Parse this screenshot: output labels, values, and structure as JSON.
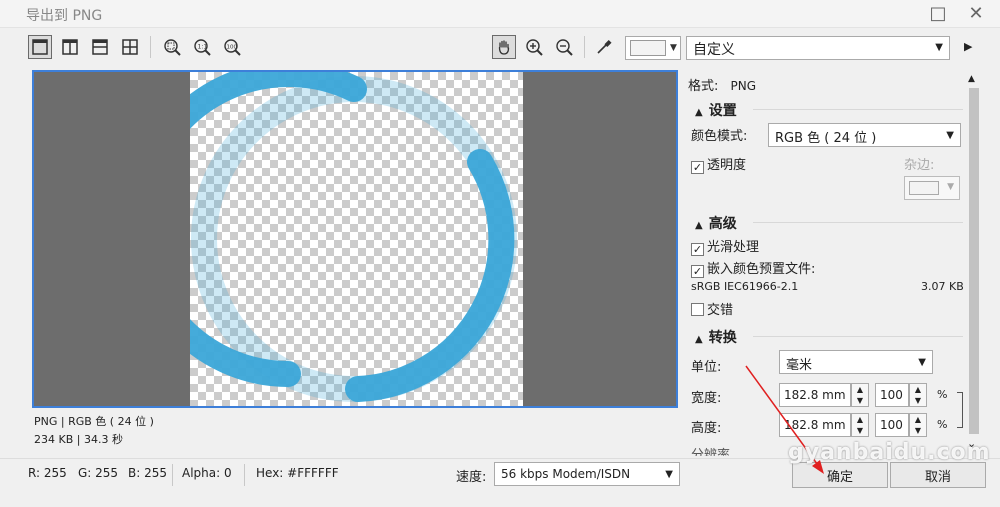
{
  "window": {
    "title": "导出到 PNG",
    "maximize_icon": "□",
    "close_icon": "✕"
  },
  "toolbar": {
    "preset": "自定义",
    "more_icon": "▶"
  },
  "preview": {
    "info_format": "PNG | RGB 色 ( 24 位 )",
    "info_size": "234 KB | 34.3 秒",
    "colors": {
      "ring": "#3ba7d8",
      "frame": "#3d7fd9",
      "background": "#6d6d6d"
    }
  },
  "panel": {
    "format_label": "格式:",
    "format_value": "PNG",
    "settings_title": "设置",
    "color_mode_label": "颜色模式:",
    "color_mode_value": "RGB 色 ( 24 位 )",
    "transparency_label": "透明度",
    "transparency_checked": "✓",
    "matte_label": "杂边:",
    "advanced_title": "高级",
    "antialias_label": "光滑处理",
    "antialias_checked": "✓",
    "embed_profile_label": "嵌入颜色预置文件:",
    "embed_profile_checked": "✓",
    "profile_name": "sRGB IEC61966-2.1",
    "profile_size": "3.07 KB",
    "interlace_label": "交错",
    "transform_title": "转换",
    "unit_label": "单位:",
    "unit_value": "毫米",
    "width_label": "宽度:",
    "width_value": "182.8 mm",
    "width_percent": "100",
    "height_label": "高度:",
    "height_value": "182.8 mm",
    "height_percent": "100",
    "percent_sign": "%",
    "resolution_label": "分辨率"
  },
  "status": {
    "r": "R: 255",
    "g": "G: 255",
    "b": "B: 255",
    "alpha": "Alpha: 0",
    "hex": "Hex: #FFFFFF",
    "speed_label": "速度:",
    "speed_value": "56 kbps Modem/ISDN"
  },
  "buttons": {
    "ok": "确定",
    "cancel": "取消"
  },
  "watermark": "gyanbaidu.com"
}
